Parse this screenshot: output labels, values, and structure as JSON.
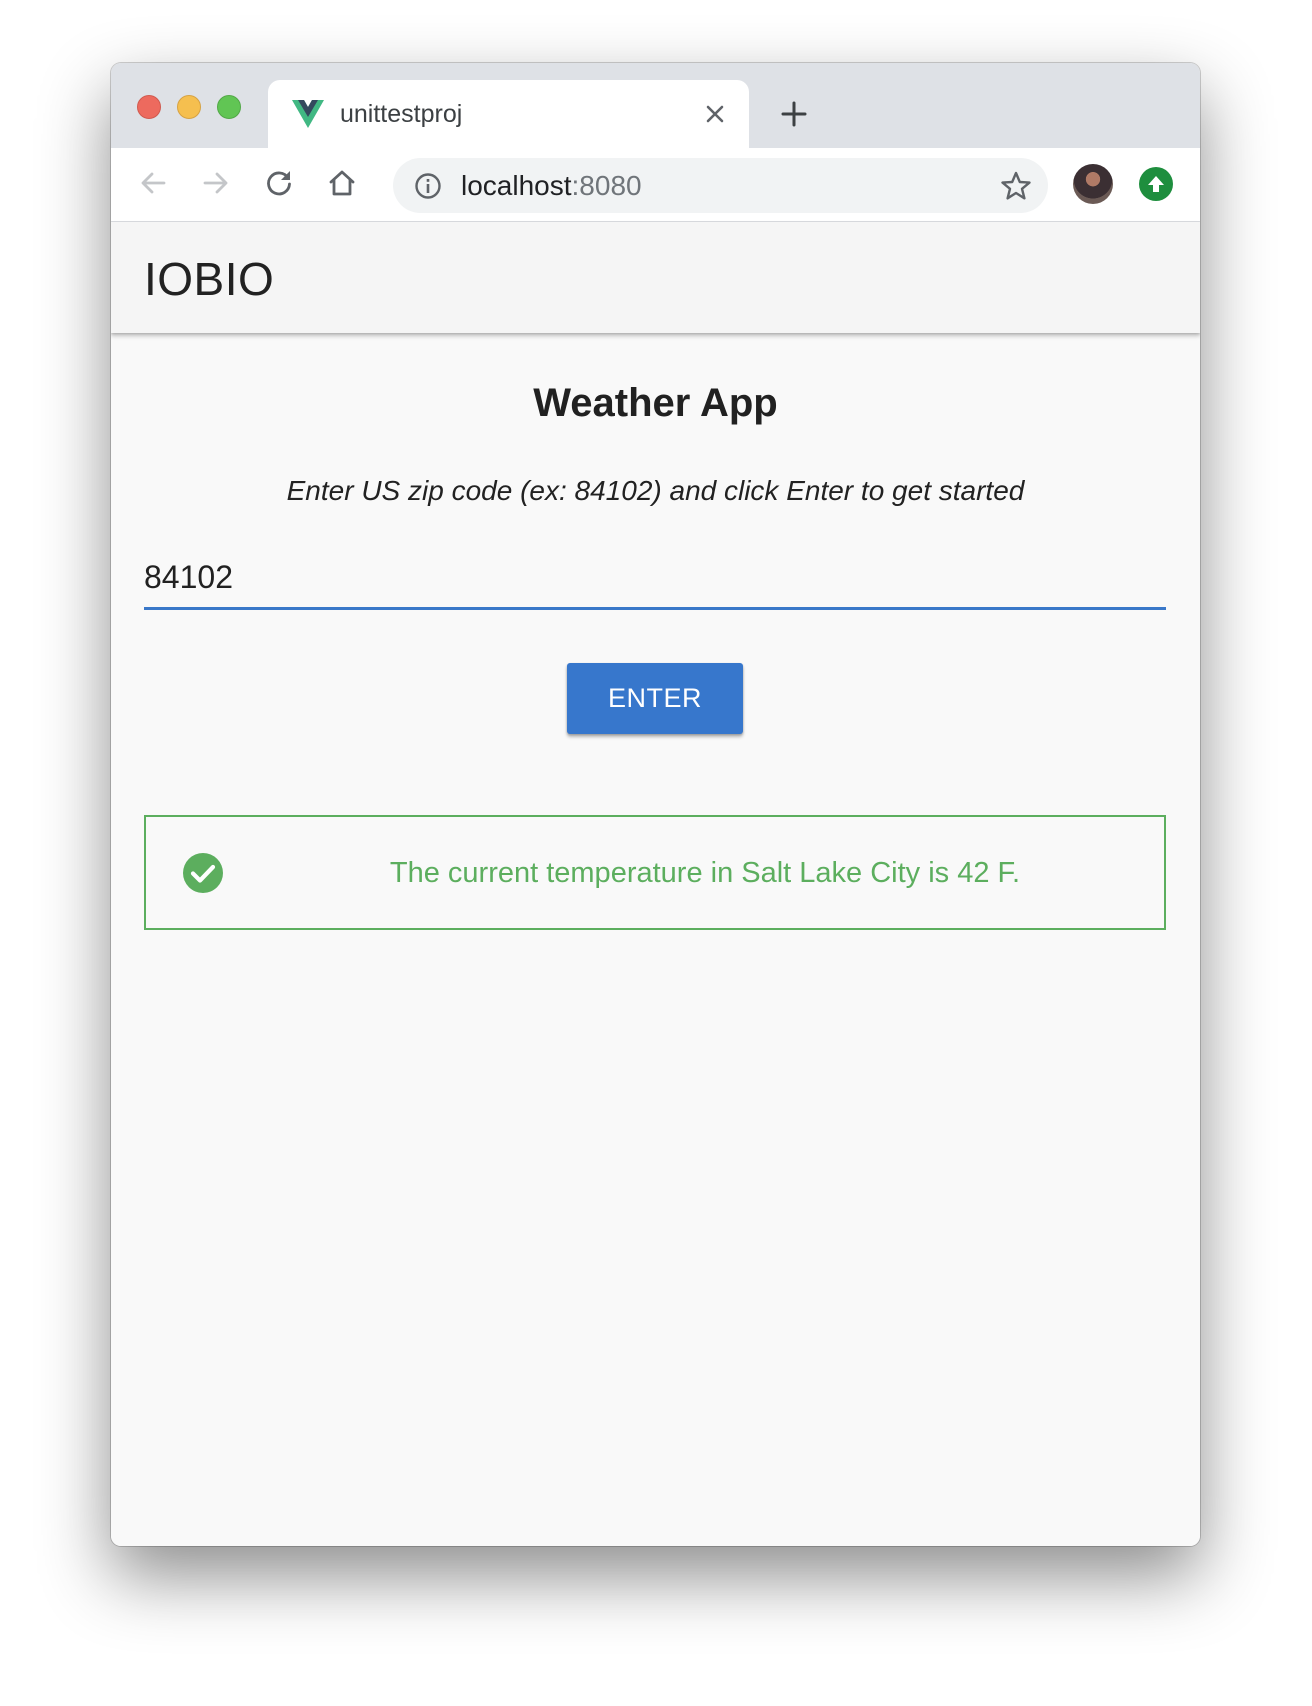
{
  "browser": {
    "tab": {
      "title": "unittestproj",
      "favicon": "vue-logo-icon"
    },
    "address": {
      "host": "localhost",
      "port": ":8080"
    },
    "colors": {
      "tabstrip": "#dee1e6",
      "update_badge": "#1e8e3e"
    }
  },
  "app": {
    "brand": "IOBIO",
    "heading": "Weather App",
    "instructions": "Enter US zip code (ex: 84102) and click Enter to get started",
    "zip_input": {
      "value": "84102"
    },
    "enter_button_label": "ENTER",
    "alert": {
      "type": "success",
      "icon": "check-circle-icon",
      "message": "The current temperature in Salt Lake City is 42 F."
    },
    "colors": {
      "primary": "#3777cc",
      "success": "#5cae5e"
    }
  }
}
